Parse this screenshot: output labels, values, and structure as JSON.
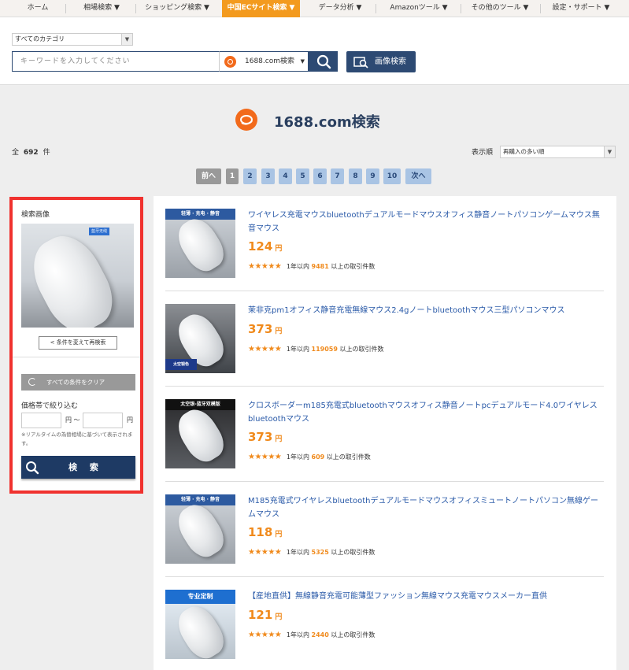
{
  "nav": {
    "items": [
      "ホーム",
      "相場検索 ▼",
      "ショッピング検索 ▼",
      "中国ECサイト検索 ▼",
      "データ分析 ▼",
      "Amazonツール ▼",
      "その他のツール ▼",
      "設定・サポート ▼"
    ],
    "active_index": 3
  },
  "search": {
    "category": "すべてのカテゴリ",
    "keyword_placeholder": "キーワードを入力してください",
    "site": "1688.com検索",
    "image_search_label": "画像検索"
  },
  "page": {
    "title": "1688.com検索",
    "total_prefix": "全",
    "total_count": "692",
    "total_suffix": "件",
    "sort_label": "表示順",
    "sort_value": "再購入の多い順"
  },
  "pagination": {
    "prev": "前へ",
    "pages": [
      "1",
      "2",
      "3",
      "4",
      "5",
      "6",
      "7",
      "8",
      "9",
      "10"
    ],
    "current": "1",
    "next": "次へ"
  },
  "sidebar": {
    "title": "検索画像",
    "image_badge": "蓝牙无线",
    "research_label": "条件を変えて再検索",
    "clear_label": "すべての条件をクリア",
    "price_title": "価格帯で絞り込む",
    "yen_min": "円 〜",
    "yen_max": "円",
    "note": "※リアルタイムの為替相場に基づいて表示されます。",
    "search_label": "検 索"
  },
  "results": [
    {
      "title": "ワイヤレス充電マウスbluetoothデュアルモードマウスオフィス静音ノートパソコンゲームマウス無音マウス",
      "price": "124",
      "unit": "円",
      "stars": "★★★★★",
      "meta_prefix": "1年以内",
      "count": "9481",
      "meta_suffix": "以上の取引件数",
      "badge": "轻薄 · 充电 · 静音"
    },
    {
      "title": "茉非克pm1オフィス静音充電無線マウス2.4gノートbluetoothマウス三型パソコンマウス",
      "price": "373",
      "unit": "円",
      "stars": "★★★★★",
      "meta_prefix": "1年以内",
      "count": "119059",
      "meta_suffix": "以上の取引件数",
      "badge": "太空银色"
    },
    {
      "title": "クロスボーダーm185充電式bluetoothマウスオフィス静音ノートpcデュアルモード4.0ワイヤレスbluetoothマウス",
      "price": "373",
      "unit": "円",
      "stars": "★★★★★",
      "meta_prefix": "1年以内",
      "count": "609",
      "meta_suffix": "以上の取引件数",
      "badge": "太空银-蓝牙双模版"
    },
    {
      "title": "M185充電式ワイヤレスbluetoothデュアルモードマウスオフィスミュートノートパソコン無線ゲームマウス",
      "price": "118",
      "unit": "円",
      "stars": "★★★★★",
      "meta_prefix": "1年以内",
      "count": "5325",
      "meta_suffix": "以上の取引件数",
      "badge": "轻薄 · 充电 · 静音"
    },
    {
      "title": "【産地直供】無線静音充電可能薄型ファッション無線マウス充電マウスメーカー直供",
      "price": "121",
      "unit": "円",
      "stars": "★★★★★",
      "meta_prefix": "1年以内",
      "count": "2440",
      "meta_suffix": "以上の取引件数",
      "badge": "专业定制"
    }
  ],
  "colors": {
    "accent_orange": "#f39a1e",
    "navy": "#2d4a73",
    "price_orange": "#f08a1c",
    "link_blue": "#2a5aa8",
    "highlight_red": "#f0312e"
  }
}
